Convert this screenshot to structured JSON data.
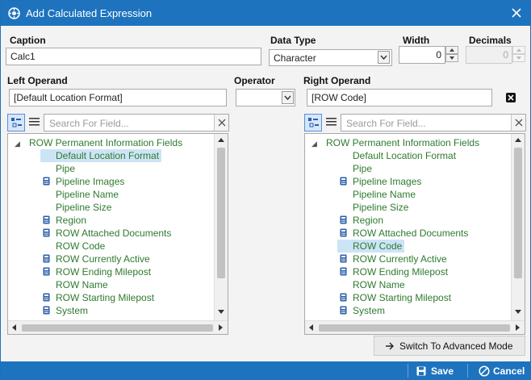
{
  "window": {
    "title": "Add Calculated Expression"
  },
  "caption": {
    "label": "Caption",
    "value": "Calc1"
  },
  "data_type": {
    "label": "Data Type",
    "value": "Character"
  },
  "width": {
    "label": "Width",
    "value": "0"
  },
  "decimals": {
    "label": "Decimals",
    "value": "0"
  },
  "left_operand": {
    "label": "Left Operand",
    "value": "[Default Location Format]"
  },
  "operator": {
    "label": "Operator",
    "value": ""
  },
  "right_operand": {
    "label": "Right Operand",
    "value": "[ROW Code]"
  },
  "left_panel": {
    "search_placeholder": "Search For Field...",
    "root": "ROW Permanent Information Fields",
    "selected": "Default Location Format",
    "items": [
      {
        "label": "Default Location Format",
        "icon": "none"
      },
      {
        "label": "Pipe",
        "icon": "none"
      },
      {
        "label": "Pipeline Images",
        "icon": "calculator"
      },
      {
        "label": "Pipeline Name",
        "icon": "none"
      },
      {
        "label": "Pipeline Size",
        "icon": "none"
      },
      {
        "label": "Region",
        "icon": "calculator"
      },
      {
        "label": "ROW Attached Documents",
        "icon": "calculator"
      },
      {
        "label": "ROW Code",
        "icon": "none"
      },
      {
        "label": "ROW Currently Active",
        "icon": "calculator"
      },
      {
        "label": "ROW Ending Milepost",
        "icon": "calculator"
      },
      {
        "label": "ROW Name",
        "icon": "none"
      },
      {
        "label": "ROW Starting Milepost",
        "icon": "calculator"
      },
      {
        "label": "System",
        "icon": "calculator"
      }
    ]
  },
  "right_panel": {
    "search_placeholder": "Search For Field...",
    "root": "ROW Permanent Information Fields",
    "selected": "ROW Code",
    "items": [
      {
        "label": "Default Location Format",
        "icon": "none"
      },
      {
        "label": "Pipe",
        "icon": "none"
      },
      {
        "label": "Pipeline Images",
        "icon": "calculator"
      },
      {
        "label": "Pipeline Name",
        "icon": "none"
      },
      {
        "label": "Pipeline Size",
        "icon": "none"
      },
      {
        "label": "Region",
        "icon": "calculator"
      },
      {
        "label": "ROW Attached Documents",
        "icon": "calculator"
      },
      {
        "label": "ROW Code",
        "icon": "none"
      },
      {
        "label": "ROW Currently Active",
        "icon": "calculator"
      },
      {
        "label": "ROW Ending Milepost",
        "icon": "calculator"
      },
      {
        "label": "ROW Name",
        "icon": "none"
      },
      {
        "label": "ROW Starting Milepost",
        "icon": "calculator"
      },
      {
        "label": "System",
        "icon": "calculator"
      }
    ]
  },
  "advanced_button": {
    "label": "Switch To Advanced Mode"
  },
  "footer": {
    "save": "Save",
    "cancel": "Cancel"
  },
  "colors": {
    "title_bar": "#1e73be",
    "tree_text": "#2f7a2f",
    "selection": "#cde4f7"
  }
}
